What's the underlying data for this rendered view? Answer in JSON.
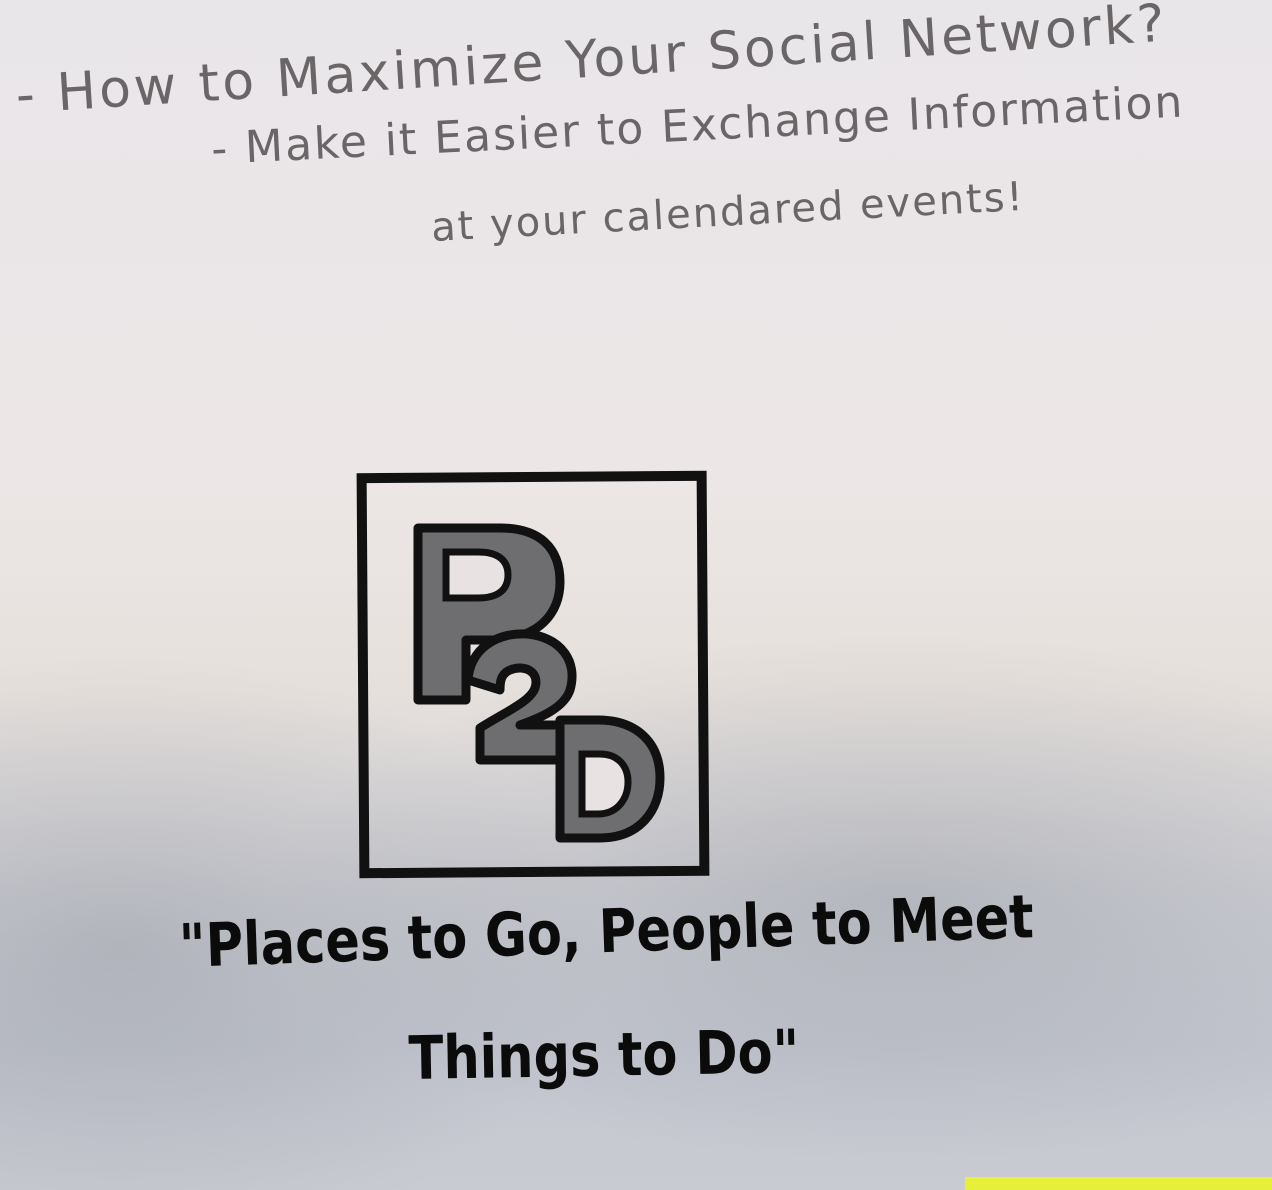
{
  "notes": {
    "line1": "- How to Maximize Your Social Network?",
    "line2": "- Make it Easier to Exchange Information",
    "line3": "at your calendared events!"
  },
  "logo": {
    "text": "P2D"
  },
  "tagline": {
    "line1": "\"Places to Go, People to Meet",
    "line2": "Things to Do\""
  },
  "colors": {
    "paper": "#ebe6e6",
    "pencil": "#6a6566",
    "ink": "#0b0b0b",
    "logo_fill": "#6e6e70",
    "sticky_note": "#e6f03a"
  }
}
